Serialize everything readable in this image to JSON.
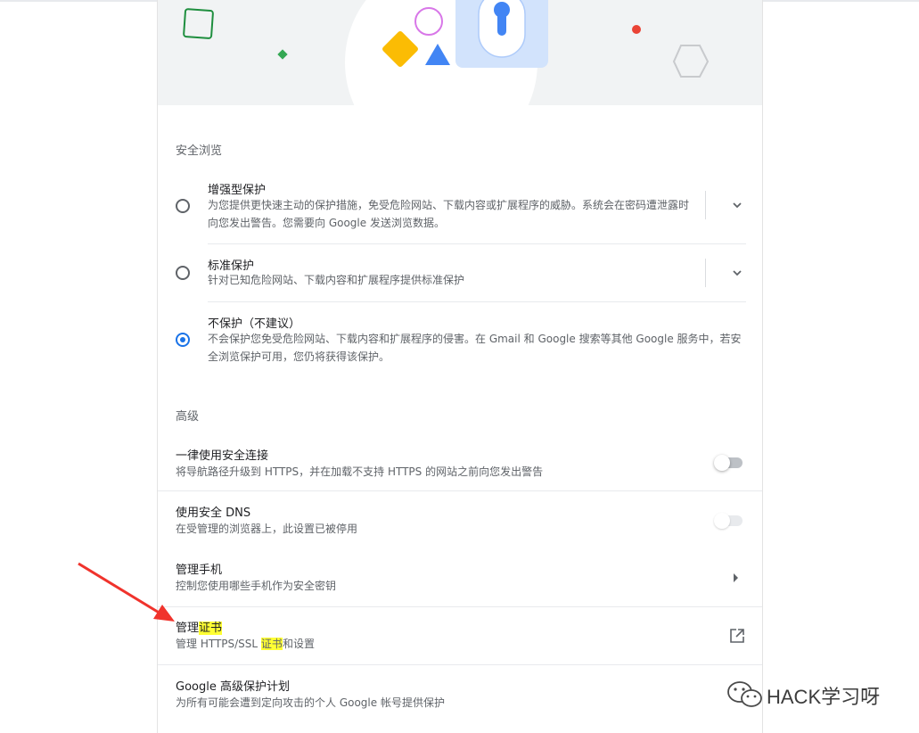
{
  "safe_browsing": {
    "section_title": "安全浏览",
    "options": [
      {
        "title": "增强型保护",
        "description": "为您提供更快速主动的保护措施，免受危险网站、下载内容或扩展程序的威胁。系统会在密码遭泄露时向您发出警告。您需要向 Google 发送浏览数据。",
        "selected": false
      },
      {
        "title": "标准保护",
        "description": "针对已知危险网站、下载内容和扩展程序提供标准保护",
        "selected": false
      },
      {
        "title": "不保护（不建议）",
        "description": "不会保护您免受危险网站、下载内容和扩展程序的侵害。在 Gmail 和 Google 搜索等其他 Google 服务中，若安全浏览保护可用，您仍将获得该保护。",
        "selected": true
      }
    ]
  },
  "advanced": {
    "section_title": "高级",
    "always_secure": {
      "title": "一律使用安全连接",
      "description": "将导航路径升级到 HTTPS，并在加载不支持 HTTPS 的网站之前向您发出警告",
      "enabled": false
    },
    "secure_dns": {
      "title": "使用安全 DNS",
      "description": "在受管理的浏览器上，此设置已被停用",
      "enabled": false,
      "disabled": true
    },
    "manage_phones": {
      "title": "管理手机",
      "description": "控制您使用哪些手机作为安全密钥"
    },
    "manage_certs": {
      "title_prefix": "管理",
      "title_highlight": "证书",
      "desc_prefix": "管理 HTTPS/SSL ",
      "desc_highlight": "证书",
      "desc_suffix": "和设置"
    },
    "advanced_protection": {
      "title": "Google 高级保护计划",
      "description": "为所有可能会遭到定向攻击的个人 Google 帐号提供保护"
    }
  },
  "watermark": {
    "text": "HACK学习呀"
  },
  "colors": {
    "accent": "#1a73e8",
    "highlight": "#ffff33",
    "annotation_arrow": "#f0332c"
  }
}
